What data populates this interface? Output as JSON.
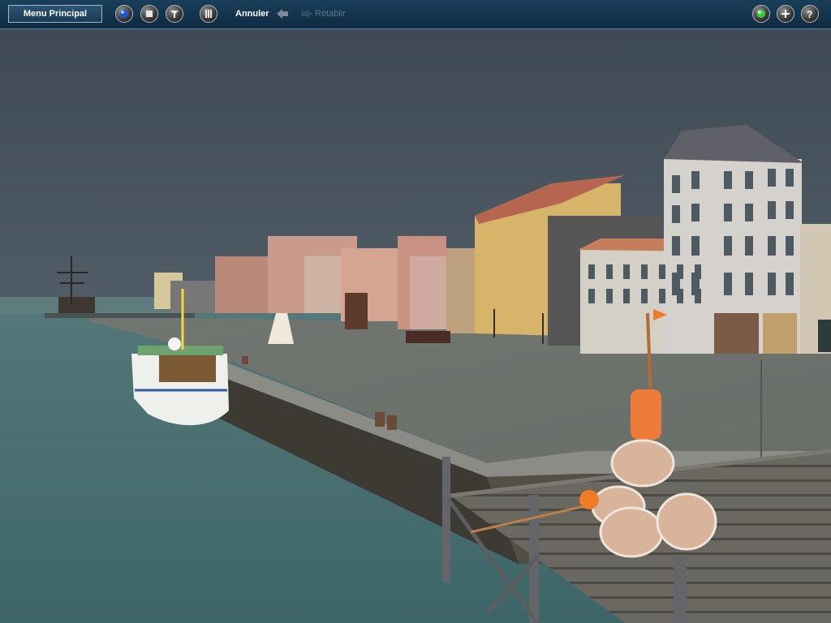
{
  "toolbar": {
    "main_menu_label": "Menu Principal",
    "undo_label": "Annuler",
    "redo_label": "Rétablir",
    "left_icons": [
      "drive-icon",
      "stop-icon",
      "tools-icon",
      "grid-icon"
    ],
    "right_icons": [
      "green-status-icon",
      "add-icon",
      "help-icon"
    ]
  },
  "colors": {
    "toolbar_bg": "#123752",
    "active_text": "#ffffff",
    "disabled_text": "#5f7486",
    "sky": "#4d5b66",
    "water": "#436c6d",
    "quay": "#777b75",
    "buoy_orange": "#ed7b39"
  }
}
